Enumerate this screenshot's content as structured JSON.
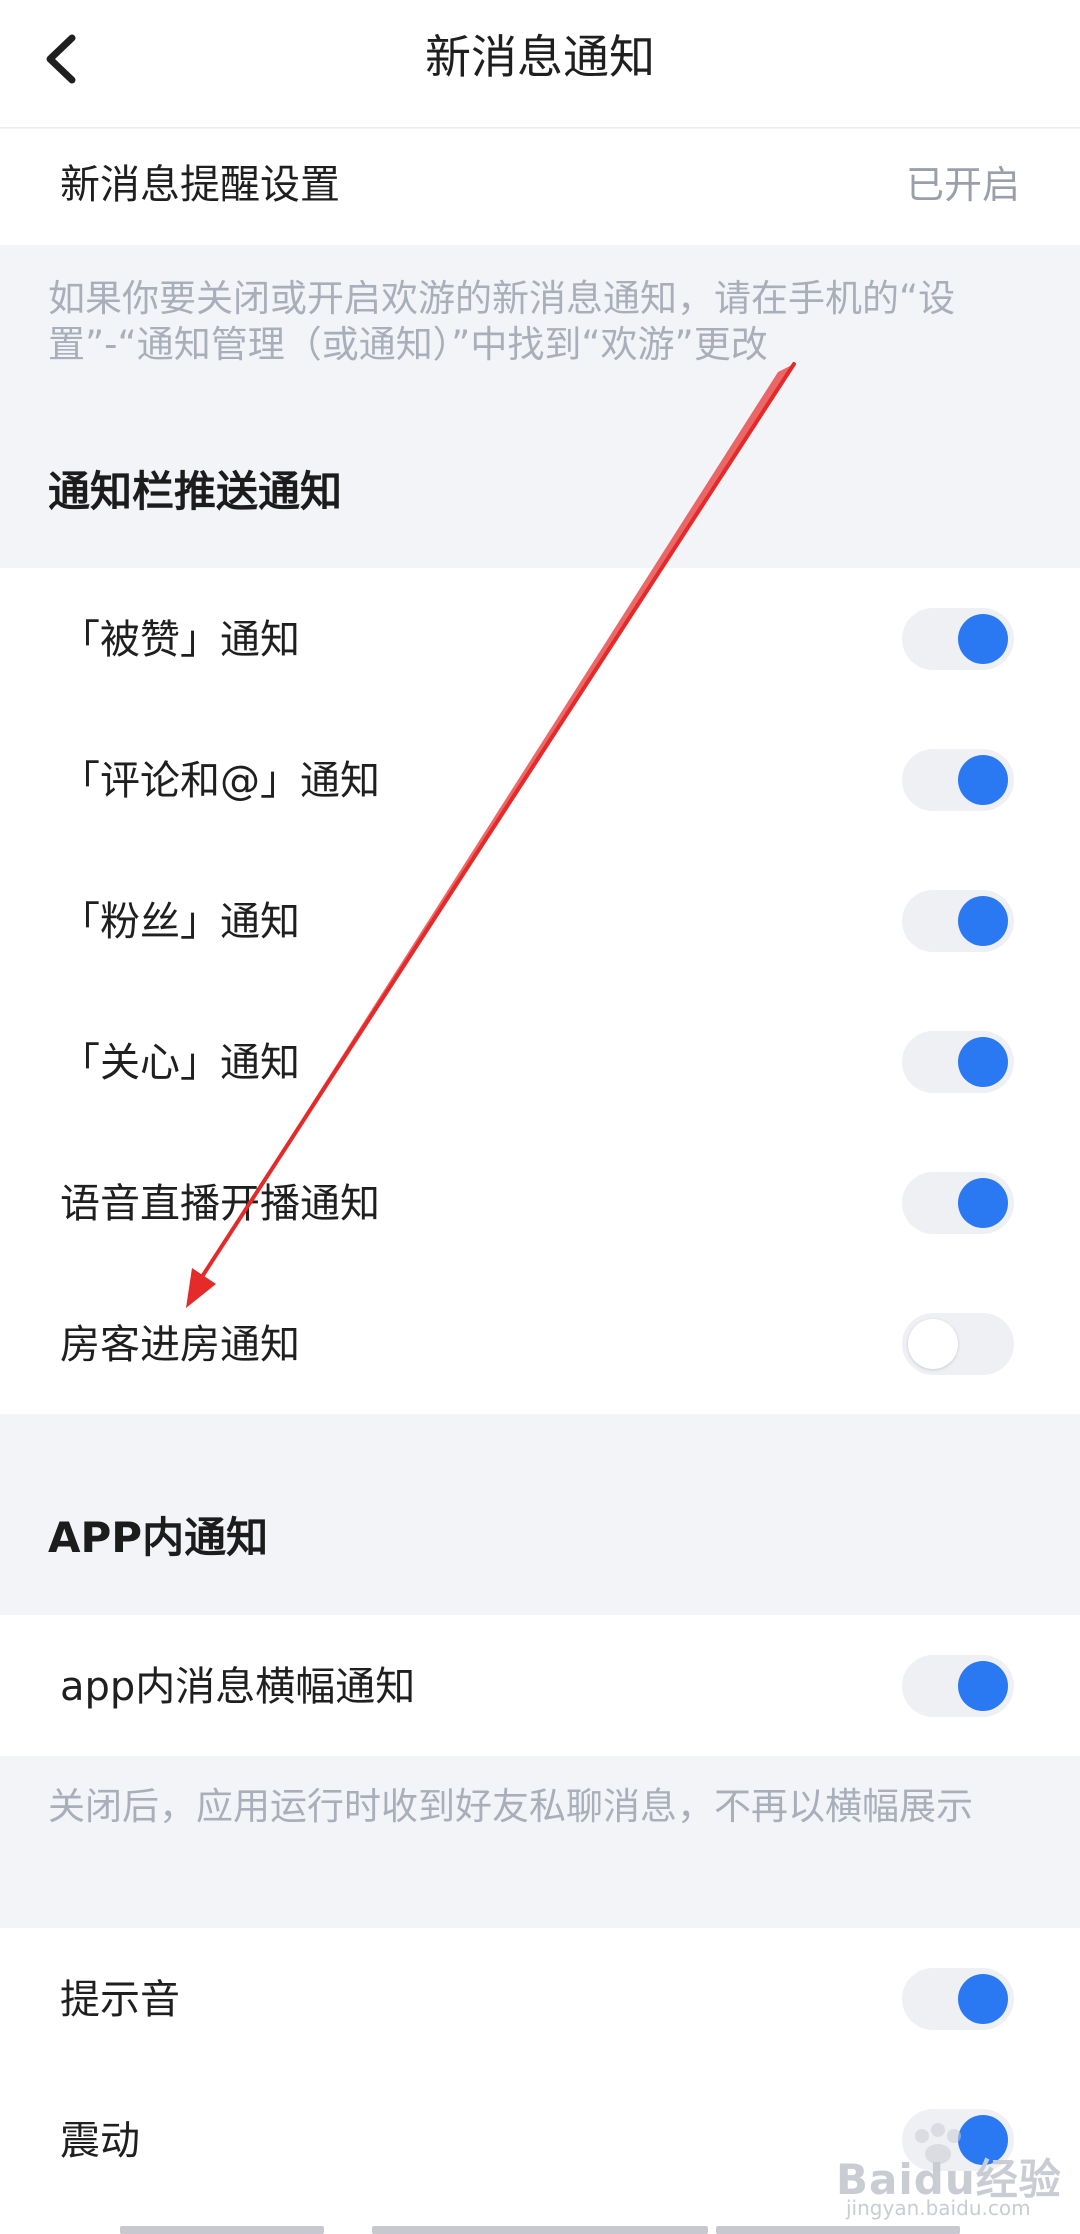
{
  "header": {
    "title": "新消息通知",
    "back_icon": "chevron-left-icon"
  },
  "reminder_setting": {
    "label": "新消息提醒设置",
    "value": "已开启"
  },
  "system_hint": "如果你要关闭或开启欢游的新消息通知，请在手机的“设置”-“通知管理（或通知）”中找到“欢游”更改",
  "push_section": {
    "title": "通知栏推送通知",
    "items": [
      {
        "label": "「被赞」通知",
        "enabled": true
      },
      {
        "label": "「评论和@」通知",
        "enabled": true
      },
      {
        "label": "「粉丝」通知",
        "enabled": true
      },
      {
        "label": "「关心」通知",
        "enabled": true
      },
      {
        "label": "语音直播开播通知",
        "enabled": true
      },
      {
        "label": "房客进房通知",
        "enabled": false
      }
    ]
  },
  "app_section": {
    "title": "APP内通知",
    "banner_label": "app内消息横幅通知",
    "banner_enabled": true,
    "banner_hint": "关闭后，应用运行时收到好友私聊消息，不再以横幅展示",
    "sound_label": "提示音",
    "sound_enabled": true,
    "vibrate_label": "震动",
    "vibrate_enabled": true
  },
  "colors": {
    "accent": "#2a78f2",
    "toggle_track": "#eff0f4",
    "background": "#f3f4f8",
    "hint_text": "#a9afba",
    "annotation_arrow": "#e52a2a"
  },
  "watermark": {
    "brand": "Baidu经验",
    "url": "jingyan.baidu.com"
  }
}
